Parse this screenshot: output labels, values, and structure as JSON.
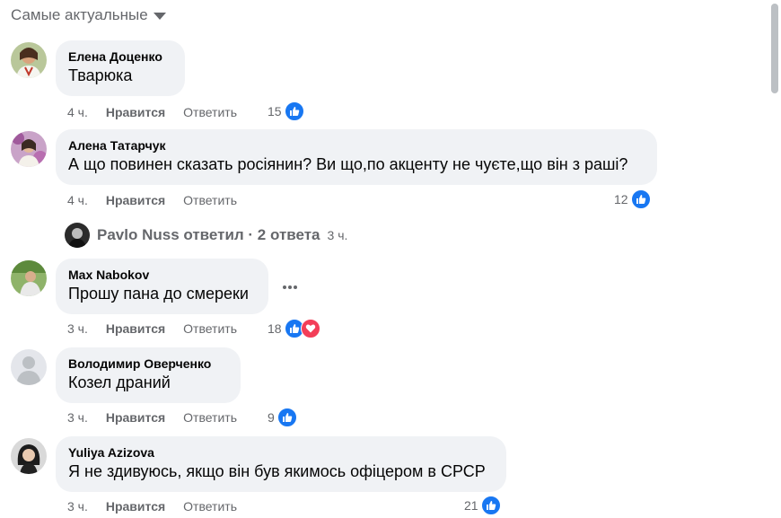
{
  "sort": {
    "label": "Самые актуальные"
  },
  "actions": {
    "like": "Нравится",
    "reply": "Ответить"
  },
  "comments": [
    {
      "author": "Елена Доценко",
      "text": "Тварюка",
      "time": "4 ч.",
      "reactions": "15"
    },
    {
      "author": "Алена Татарчук",
      "text": "А що повинен сказать росіянин? Ви що,по акценту не чуєте,що він з раші?",
      "time": "4 ч.",
      "reactions": "12"
    },
    {
      "author": "Max Nabokov",
      "text": "Прошу пана до смереки",
      "time": "3 ч.",
      "reactions": "18"
    },
    {
      "author": "Володимир Оверченко",
      "text": "Козел драний",
      "time": "3 ч.",
      "reactions": "9"
    },
    {
      "author": "Yuliya Azizova",
      "text": "Я не здивуюсь, якщо він був якимось офіцером в СРСР",
      "time": "3 ч.",
      "reactions": "21"
    }
  ],
  "replies": {
    "text": "Pavlo Nuss ответил · 2 ответа",
    "time": "3 ч."
  },
  "colors": {
    "like": "#1877f2",
    "love": "#f33e58",
    "bubble": "#f0f2f5",
    "secondary_text": "#65676b"
  },
  "icons": [
    "caret-down-icon",
    "like-icon",
    "love-icon",
    "more-icon"
  ]
}
